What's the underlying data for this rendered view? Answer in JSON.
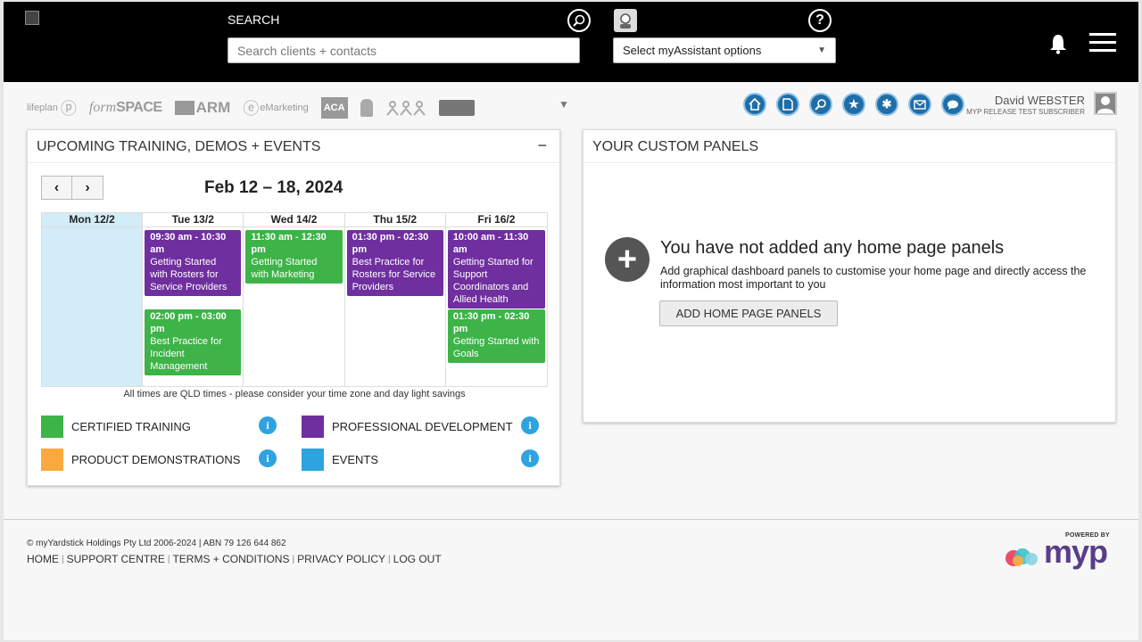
{
  "header": {
    "search_label": "SEARCH",
    "search_placeholder": "Search clients + contacts",
    "assistant_select": "Select myAssistant options",
    "icons": [
      "broken-logo-icon",
      "zoom-search-icon",
      "assistant-icon",
      "help-icon",
      "bell-icon",
      "hamburger-menu-icon"
    ]
  },
  "products": [
    "lifeplan",
    "formSPACE",
    "ARM",
    "eMarketing",
    "ACA",
    "",
    "",
    ""
  ],
  "product_labels": {
    "lifeplan": "lifeplan",
    "formspace_italic": "form",
    "formspace_bold": "SPACE",
    "arm": "ARM",
    "emarketing": "eMarketing",
    "aca": "ACA"
  },
  "quick_icons": [
    "home-icon",
    "document-icon",
    "search-icon",
    "star-icon",
    "snowflake-icon",
    "mail-icon",
    "chat-icon"
  ],
  "user": {
    "name": "David WEBSTER",
    "subtitle": "MYP RELEASE TEST SUBSCRIBER"
  },
  "training_panel": {
    "title": "UPCOMING TRAINING, DEMOS + EVENTS",
    "collapse": "−",
    "prev": "‹",
    "next": "›",
    "week": "Feb 12 – 18, 2024",
    "days": [
      {
        "label": "Mon 12/2",
        "today": true,
        "events": []
      },
      {
        "label": "Tue 13/2",
        "events": [
          {
            "time": "09:30 am - 10:30 am",
            "title": "Getting Started with Rosters for Service Providers",
            "type": "professional"
          },
          {
            "time": "02:00 pm - 03:00 pm",
            "title": "Best Practice for Incident Management",
            "type": "certified"
          }
        ]
      },
      {
        "label": "Wed 14/2",
        "events": [
          {
            "time": "11:30 am - 12:30 pm",
            "title": "Getting Started with Marketing",
            "type": "certified"
          }
        ]
      },
      {
        "label": "Thu 15/2",
        "events": [
          {
            "time": "01:30 pm - 02:30 pm",
            "title": "Best Practice for Rosters for Service Providers",
            "type": "professional"
          }
        ]
      },
      {
        "label": "Fri 16/2",
        "events": [
          {
            "time": "10:00 am - 11:30 am",
            "title": "Getting Started for Support Coordinators and Allied Health",
            "type": "professional"
          },
          {
            "time": "01:30 pm - 02:30 pm",
            "title": "Getting Started with Goals",
            "type": "certified"
          }
        ]
      }
    ],
    "tz_note": "All times are QLD times - please consider your time zone and day light savings",
    "legend": [
      {
        "label": "CERTIFIED TRAINING",
        "color": "#3db348"
      },
      {
        "label": "PROFESSIONAL DEVELOPMENT",
        "color": "#6f2f9f"
      },
      {
        "label": "PRODUCT DEMONSTRATIONS",
        "color": "#f9a93f"
      },
      {
        "label": "EVENTS",
        "color": "#2ea3e0"
      }
    ],
    "info_glyph": "i"
  },
  "custom_panel": {
    "title": "YOUR CUSTOM PANELS",
    "empty_title": "You have not added any home page panels",
    "empty_desc": "Add graphical dashboard panels to customise your home page and directly access the information most important to you",
    "button": "ADD HOME PAGE PANELS",
    "add_glyph": "+"
  },
  "footer": {
    "copyright": "© myYardstick Holdings Pty Ltd 2006-2024 | ABN 79 126 644 862",
    "links": [
      "HOME",
      "SUPPORT CENTRE",
      "TERMS + CONDITIONS",
      "PRIVACY POLICY",
      "LOG OUT"
    ],
    "powered_by": "POWERED BY",
    "brand": "myp"
  },
  "colors": {
    "header_bg": "#000000",
    "certified": "#3db348",
    "professional": "#6f2f9f",
    "demonstrations": "#f9a93f",
    "events": "#2ea3e0",
    "today": "#d2ecf8",
    "brand_purple": "#5a3d8a"
  }
}
